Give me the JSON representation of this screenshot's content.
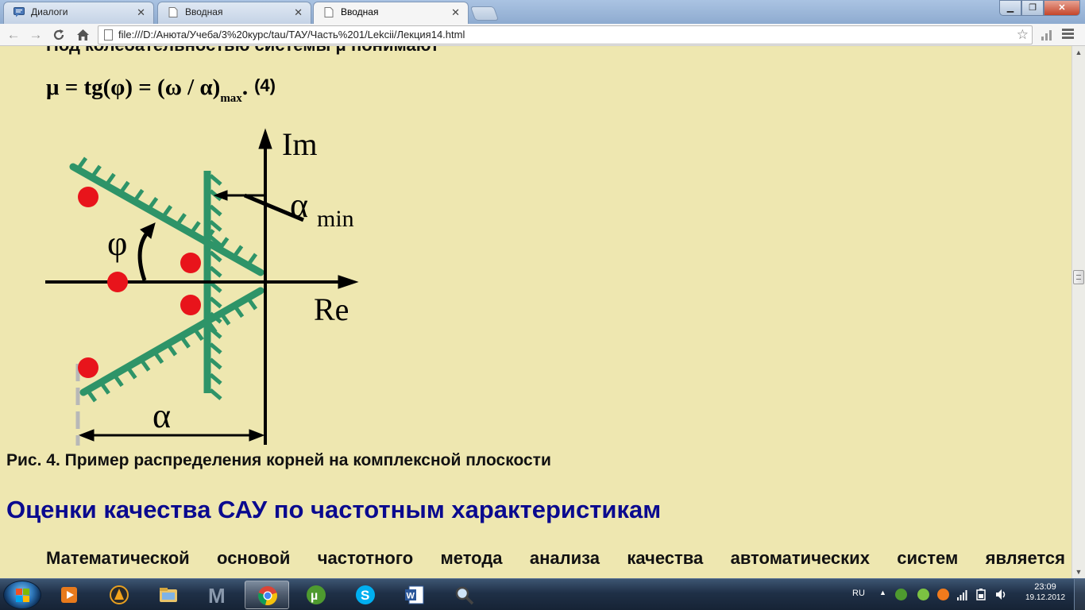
{
  "browser": {
    "tabs": [
      {
        "label": "Диалоги",
        "active": false
      },
      {
        "label": "Вводная",
        "active": false
      },
      {
        "label": "Вводная",
        "active": true
      }
    ],
    "url": "file:///D:/Анюта/Учеба/3%20курс/tau/ТАУ/Часть%201/Lekcii/Лекция14.html"
  },
  "page": {
    "partial_line": "Под колебательностью системы μ понимают",
    "formula": {
      "lhs": "μ = tg(φ) = (ω / α)",
      "sub": "max",
      "dot": ".",
      "eqno": "(4)"
    },
    "figure": {
      "label_im": "Im",
      "label_re": "Re",
      "label_alpha_min_symbol": "α",
      "label_alpha_min_sub": "min",
      "label_phi": "φ",
      "label_alpha": "α",
      "colors": {
        "hatch": "#2e9468",
        "root": "#e8141b",
        "axis": "#000000",
        "dash": "#b8b8b8"
      }
    },
    "caption": "Рис. 4. Пример распределения корней на комплексной плоскости",
    "section_heading": "Оценки качества САУ по частотным характеристикам",
    "paragraph": "Математической основой частотного метода анализа качества автоматических систем является"
  },
  "taskbar": {
    "items": [
      "start-orb",
      "media-player",
      "vlc",
      "file-manager",
      "mathcad",
      "chrome",
      "utorrent",
      "skype",
      "word",
      "magnifier"
    ],
    "active_item": "chrome",
    "language": "RU",
    "time": "23:09",
    "date": "19.12.2012"
  }
}
